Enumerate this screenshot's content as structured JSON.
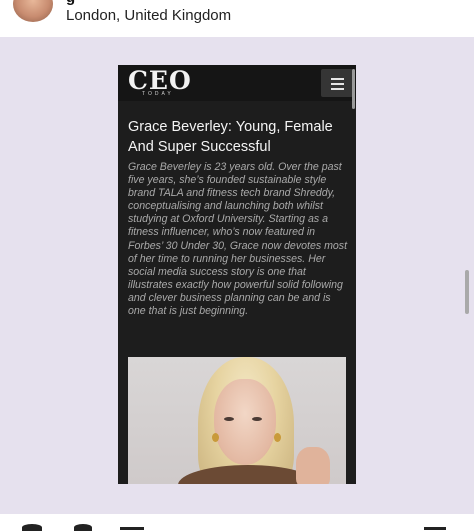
{
  "post_header": {
    "location": "London, United Kingdom",
    "avatar_icon": "profile-avatar",
    "more_icon": "more-options-icon"
  },
  "article": {
    "logo_main": "CEO",
    "logo_sub": "TODAY",
    "menu_icon": "hamburger-menu-icon",
    "title": "Grace Beverley: Young, Female And Super Successful",
    "body": "Grace Beverley is 23 years old. Over the past five years, she’s founded sustainable style brand TALA and fitness tech brand Shreddy, conceptualising and launching both whilst studying at Oxford University. Starting as a fitness influencer, who’s now featured in Forbes’ 30 Under 30, Grace now devotes most of her time to running her businesses. Her social media success story is one that illustrates exactly how powerful solid following and clever business planning can be and is one that is just beginning."
  },
  "colors": {
    "post_background": "#e6e1ee",
    "article_background": "#1d1d1d",
    "title_text": "#f4f4f4",
    "body_text": "#a9a9a9"
  }
}
